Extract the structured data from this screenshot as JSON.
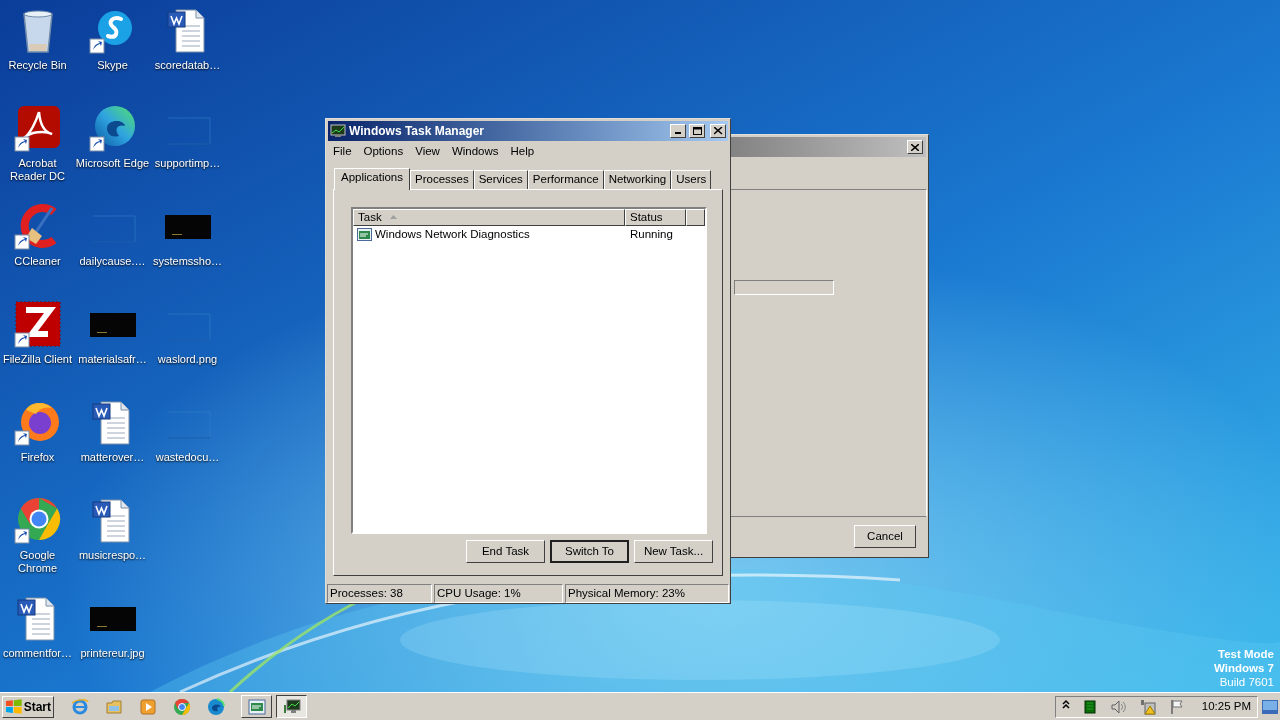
{
  "desktop_rows": [
    [
      {
        "label": "Recycle Bin",
        "kind": "recycle_bin",
        "shortcut": false
      },
      {
        "label": "Skype",
        "kind": "skype",
        "shortcut": true
      },
      {
        "label": "scoredatab…",
        "kind": "word",
        "shortcut": false
      }
    ],
    [
      {
        "label": "Acrobat\nReader DC",
        "kind": "acrobat",
        "shortcut": true
      },
      {
        "label": "Microsoft Edge",
        "kind": "edge",
        "shortcut": true
      },
      {
        "label": "supportimp…",
        "kind": "thumbnail_blank",
        "shortcut": false
      }
    ],
    [
      {
        "label": "CCleaner",
        "kind": "ccleaner",
        "shortcut": true
      },
      {
        "label": "dailycause.…",
        "kind": "thumbnail_blank",
        "shortcut": false
      },
      {
        "label": "systemssho…",
        "kind": "thumbnail_dark",
        "shortcut": false
      }
    ],
    [
      {
        "label": "FileZilla Client",
        "kind": "filezilla",
        "shortcut": true
      },
      {
        "label": "materialsafr…",
        "kind": "thumbnail_dark",
        "shortcut": false
      },
      {
        "label": "waslord.png",
        "kind": "thumbnail_blank",
        "shortcut": false
      }
    ],
    [
      {
        "label": "Firefox",
        "kind": "firefox",
        "shortcut": true
      },
      {
        "label": "matterover…",
        "kind": "word",
        "shortcut": false
      },
      {
        "label": "wastedocu…",
        "kind": "thumbnail_blank",
        "shortcut": false
      }
    ],
    [
      {
        "label": "Google\nChrome",
        "kind": "chrome",
        "shortcut": true
      },
      {
        "label": "musicrespo…",
        "kind": "word",
        "shortcut": false
      }
    ],
    [
      {
        "label": "commentfor…",
        "kind": "word",
        "shortcut": false
      },
      {
        "label": "printereur.jpg",
        "kind": "thumbnail_dark",
        "shortcut": false
      }
    ]
  ],
  "background_window": {
    "buttons": [
      "Cancel"
    ]
  },
  "task_manager": {
    "title": "Windows Task Manager",
    "menu": [
      "File",
      "Options",
      "View",
      "Windows",
      "Help"
    ],
    "tabs": [
      {
        "label": "Applications",
        "selected": true
      },
      {
        "label": "Processes",
        "selected": false
      },
      {
        "label": "Services",
        "selected": false
      },
      {
        "label": "Performance",
        "selected": false
      },
      {
        "label": "Networking",
        "selected": false
      },
      {
        "label": "Users",
        "selected": false
      }
    ],
    "columns": [
      {
        "label": "Task",
        "sorted": true
      },
      {
        "label": "Status",
        "sorted": false
      }
    ],
    "rows": [
      {
        "task": "Windows Network Diagnostics",
        "status": "Running"
      }
    ],
    "buttons": [
      {
        "label": "End Task",
        "focused": false
      },
      {
        "label": "Switch To",
        "focused": true
      },
      {
        "label": "New Task...",
        "focused": false
      }
    ],
    "status_bar": [
      "Processes: 38",
      "CPU Usage: 1%",
      "Physical Memory: 23%"
    ]
  },
  "system_notice": [
    "Test Mode",
    "Windows 7",
    "Build 7601"
  ],
  "taskbar": {
    "start": "Start",
    "quick_launch": [
      {
        "kind": "ie"
      },
      {
        "kind": "folder"
      },
      {
        "kind": "media"
      },
      {
        "kind": "chrome"
      },
      {
        "kind": "edge"
      }
    ],
    "tasks": [
      {
        "kind": "diagnostics",
        "pressed": false
      },
      {
        "kind": "taskmanager",
        "pressed": true
      }
    ],
    "tray_icons": [
      {
        "kind": "chevron"
      },
      {
        "kind": "meter"
      },
      {
        "kind": "speaker"
      },
      {
        "kind": "network_warning"
      },
      {
        "kind": "flag"
      }
    ],
    "clock": "10:25 PM"
  }
}
